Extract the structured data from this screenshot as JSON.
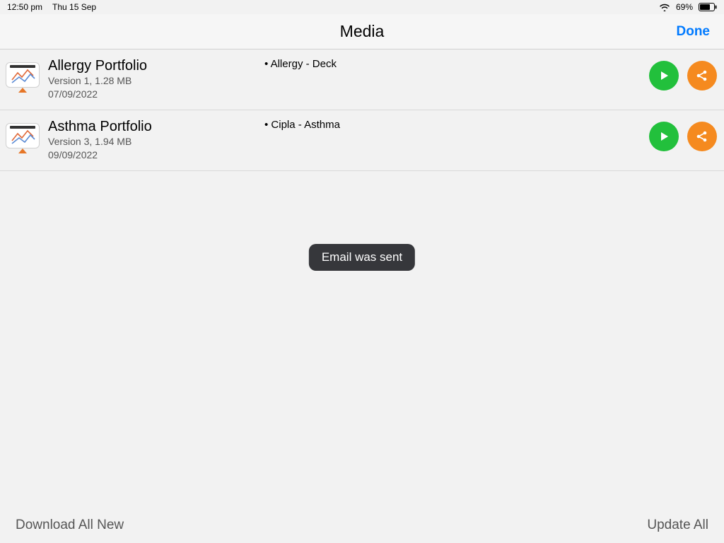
{
  "status": {
    "time": "12:50 pm",
    "date": "Thu 15 Sep",
    "battery_percent": "69%"
  },
  "nav": {
    "title": "Media",
    "done": "Done"
  },
  "media": [
    {
      "title": "Allergy Portfolio",
      "version_line": "Version 1, 1.28 MB",
      "date": "07/09/2022",
      "tag": "• Allergy - Deck"
    },
    {
      "title": "Asthma Portfolio",
      "version_line": "Version 3, 1.94 MB",
      "date": "09/09/2022",
      "tag": "• Cipla - Asthma"
    }
  ],
  "toast": "Email was sent",
  "footer": {
    "download_all_new": "Download All New",
    "update_all": "Update All"
  }
}
